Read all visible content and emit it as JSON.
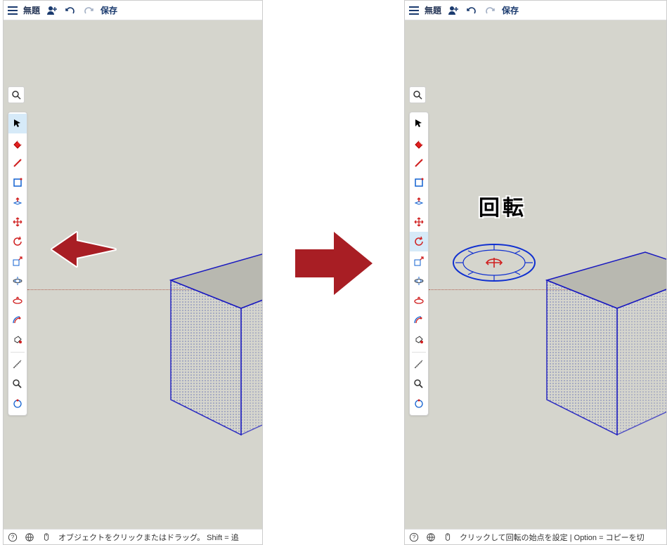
{
  "topbar": {
    "title": "無題",
    "save": "保存"
  },
  "left": {
    "status": "オブジェクトをクリックまたはドラッグ。 Shift = 追",
    "selected_tool": "select"
  },
  "right": {
    "status": "クリックして回転の始点を設定 | Option = コピーを切",
    "selected_tool": "rotate",
    "rotate_label": "回転"
  },
  "tools": [
    {
      "id": "select",
      "label": "選択"
    },
    {
      "id": "eraser",
      "label": "消しゴム"
    },
    {
      "id": "line",
      "label": "線"
    },
    {
      "id": "rectangle",
      "label": "長方形"
    },
    {
      "id": "pushpull",
      "label": "プッシュ/プル"
    },
    {
      "id": "move",
      "label": "移動"
    },
    {
      "id": "rotate",
      "label": "回転"
    },
    {
      "id": "scale",
      "label": "尺度"
    },
    {
      "id": "orbit",
      "label": "オービット"
    },
    {
      "id": "followme",
      "label": "フォローミー"
    },
    {
      "id": "offset",
      "label": "オフセット"
    },
    {
      "id": "paint",
      "label": "ペイント"
    }
  ],
  "tools2": [
    {
      "id": "tape",
      "label": "メジャー"
    },
    {
      "id": "zoom",
      "label": "ズーム"
    },
    {
      "id": "undo-circ",
      "label": "元に戻す"
    }
  ]
}
